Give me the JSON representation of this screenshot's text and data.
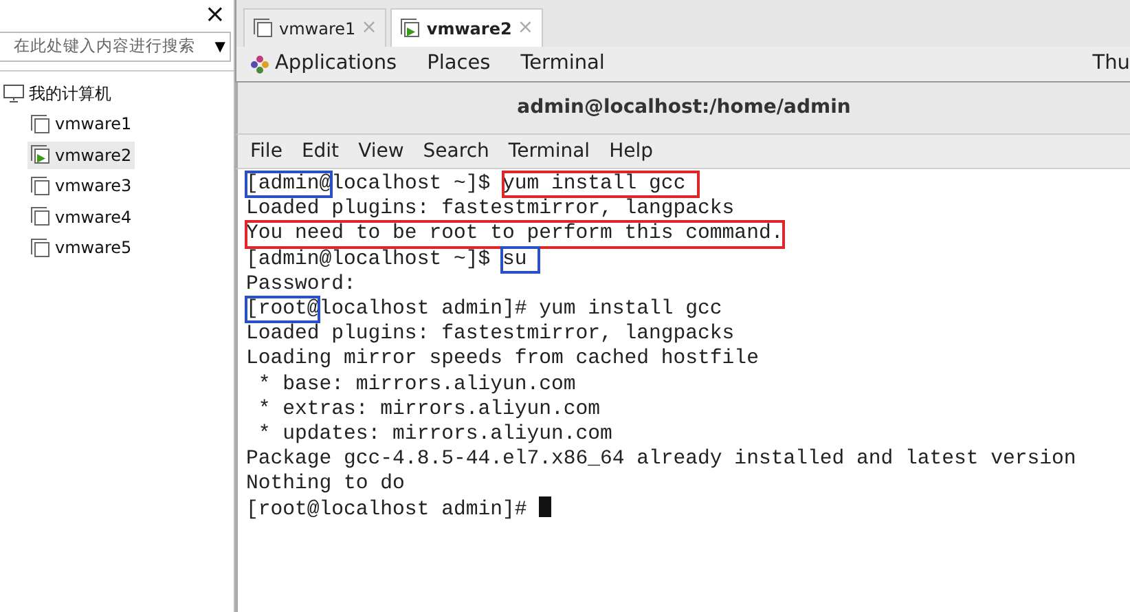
{
  "sidebar": {
    "close": "×",
    "search": {
      "placeholder": "在此处键入内容进行搜索",
      "dropdown": "▼"
    },
    "tree": [
      {
        "label": "我的计算机",
        "selected": false,
        "children": [
          {
            "label": "vmware1",
            "running": false,
            "selected": false
          },
          {
            "label": "vmware2",
            "running": true,
            "selected": true
          },
          {
            "label": "vmware3",
            "running": false,
            "selected": false
          },
          {
            "label": "vmware4",
            "running": false,
            "selected": false
          },
          {
            "label": "vmware5",
            "running": false,
            "selected": false
          }
        ]
      }
    ]
  },
  "tabs": [
    {
      "label": "vmware1",
      "running": false,
      "selected": false,
      "close": "×"
    },
    {
      "label": "vmware2",
      "running": true,
      "selected": true,
      "close": "×"
    }
  ],
  "top_bar": {
    "menus": [
      "Applications",
      "Places",
      "Terminal"
    ],
    "clock": "Thu"
  },
  "window": {
    "title": "admin@localhost:/home/admin"
  },
  "menu_bar": [
    "File",
    "Edit",
    "View",
    "Search",
    "Terminal",
    "Help"
  ],
  "terminal": {
    "lines": [
      [
        {
          "text": "[admin@",
          "color": "#2b50c4"
        },
        {
          "text": "localhost ~]$ "
        },
        {
          "text": "yum install gcc ",
          "color": "#e0262b"
        }
      ],
      [
        {
          "text": "Loaded plugins: fastestmirror, langpacks"
        }
      ],
      [
        {
          "text": "You need to be root to perform this command.",
          "color": "#e0262b"
        }
      ],
      [
        {
          "text": "[admin@localhost ~]$ "
        },
        {
          "text": "su ",
          "color": "#2b50c4"
        }
      ],
      [
        {
          "text": "Password:"
        }
      ],
      [
        {
          "text": "[root@",
          "color": "#2b50c4"
        },
        {
          "text": "localhost admin]# yum install gcc"
        }
      ],
      [
        {
          "text": "Loaded plugins: fastestmirror, langpacks"
        }
      ],
      [
        {
          "text": "Loading mirror speeds from cached hostfile"
        }
      ],
      [
        {
          "text": " * base: mirrors.aliyun.com"
        }
      ],
      [
        {
          "text": " * extras: mirrors.aliyun.com"
        }
      ],
      [
        {
          "text": " * updates: mirrors.aliyun.com"
        }
      ],
      [
        {
          "text": "Package gcc-4.8.5-44.el7.x86_64 already installed and latest version"
        }
      ],
      [
        {
          "text": "Nothing to do"
        }
      ],
      [
        {
          "text": "[root@localhost admin]# "
        },
        {
          "kind": "cursor"
        }
      ]
    ]
  }
}
